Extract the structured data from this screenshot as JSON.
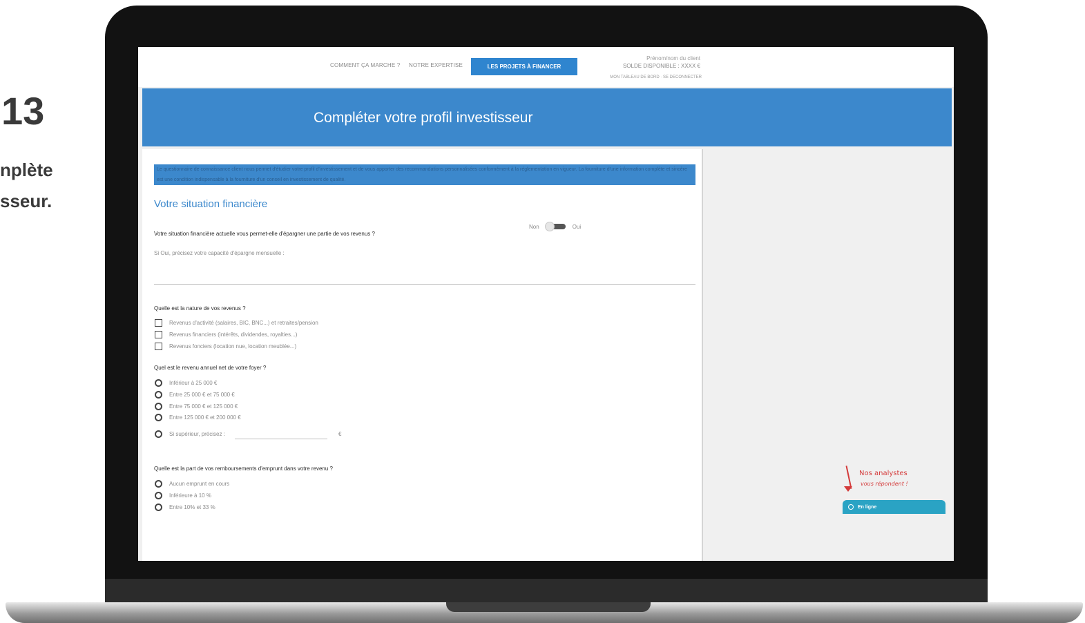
{
  "slide": {
    "number": "13",
    "caption_line1": "nplète",
    "caption_line2": "sseur."
  },
  "nav": {
    "link1": "COMMENT ÇA MARCHE ?",
    "link2": "NOTRE EXPERTISE",
    "active": "LES PROJETS À FINANCER",
    "client_name": "Prénom/nom du client",
    "client_balance": "SOLDE DISPONIBLE : XXXX €",
    "client_links": "MON TABLEAU DE BORD · SE DECONNECTER"
  },
  "banner": {
    "title": "Compléter votre profil investisseur"
  },
  "form": {
    "disclaimer": "Le questionnaire de connaissance client nous permet d'étudier votre profil d'investissement et de vous apporter des recommandations personnalisées conformément à la réglementation en vigueur. La fourniture d'une information complète et sincère est une condition indispensable à la fourniture d'un conseil en investissement de qualité.",
    "section_title": "Votre situation financière",
    "q1": "Votre situation financière actuelle vous permet-elle d'épargner une partie de vos revenus ?",
    "toggle": {
      "off_label": "Non",
      "on_label": "Oui"
    },
    "q1_hint": "Si Oui, précisez votre capacité d'épargne mensuelle :",
    "q2": "Quelle est la nature de vos revenus ?",
    "q2_options": [
      "Revenus d'activité (salaires, BIC, BNC...) et retraites/pension",
      "Revenus financiers (intérêts, dividendes, royalties...)",
      "Revenus fonciers (location nue, location meublée...)"
    ],
    "q3": "Quel est le revenu annuel net de votre foyer ?",
    "q3_options": [
      "Inférieur à 25 000 €",
      "Entre 25 000 € et 75 000 €",
      "Entre 75 000 € et 125 000 €",
      "Entre 125 000 € et 200 000 €"
    ],
    "q3_other": "Si supérieur, précisez :",
    "q3_currency": "€",
    "q4": "Quelle est la part de vos remboursements d'emprunt dans votre revenu ?",
    "q4_options": [
      "Aucun emprunt en cours",
      "Inférieure à 10 %",
      "Entre 10% et 33 %"
    ]
  },
  "chat": {
    "line1": "Nos analystes",
    "line2": "vous répondent !",
    "button": "En ligne"
  }
}
